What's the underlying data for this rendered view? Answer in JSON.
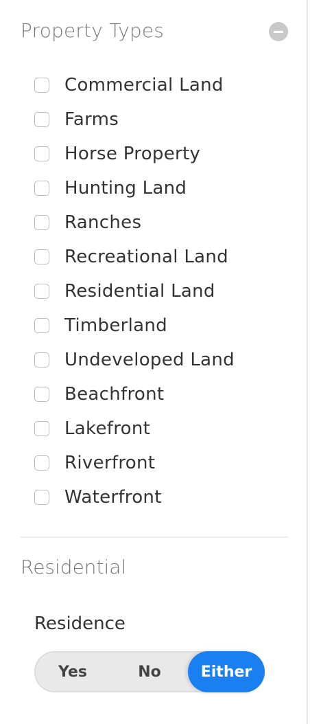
{
  "property_types": {
    "title": "Property Types",
    "collapse_icon": "minus-circle-icon",
    "items": [
      {
        "label": "Commercial Land",
        "checked": false
      },
      {
        "label": "Farms",
        "checked": false
      },
      {
        "label": "Horse Property",
        "checked": false
      },
      {
        "label": "Hunting Land",
        "checked": false
      },
      {
        "label": "Ranches",
        "checked": false
      },
      {
        "label": "Recreational Land",
        "checked": false
      },
      {
        "label": "Residential Land",
        "checked": false
      },
      {
        "label": "Timberland",
        "checked": false
      },
      {
        "label": "Undeveloped Land",
        "checked": false
      },
      {
        "label": "Beachfront",
        "checked": false
      },
      {
        "label": "Lakefront",
        "checked": false
      },
      {
        "label": "Riverfront",
        "checked": false
      },
      {
        "label": "Waterfront",
        "checked": false
      }
    ]
  },
  "residential": {
    "title": "Residential",
    "residence_label": "Residence",
    "options": [
      "Yes",
      "No",
      "Either"
    ],
    "selected": "Either"
  },
  "colors": {
    "accent": "#1a7ff0",
    "section_title": "#777777",
    "text": "#333333",
    "toggle_bg": "#e9e9e9"
  }
}
